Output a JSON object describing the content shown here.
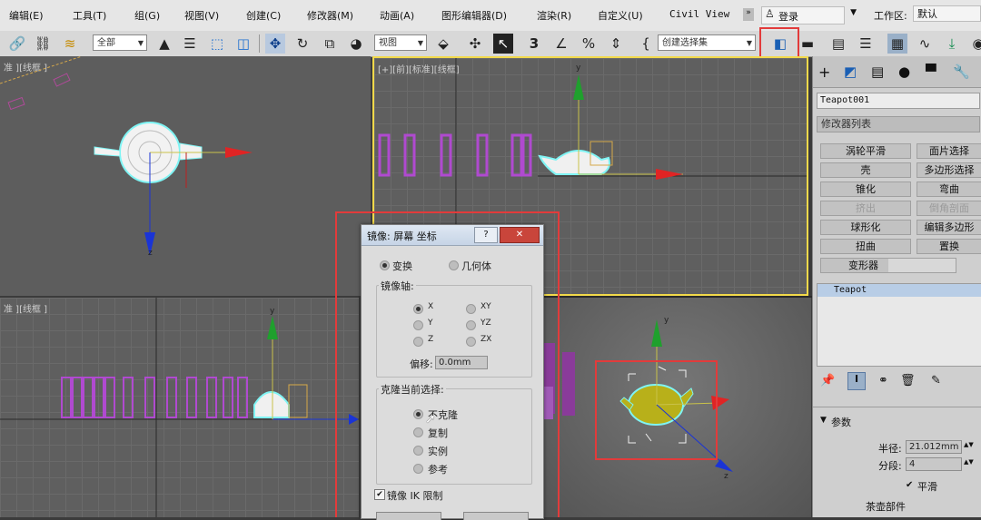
{
  "menubar": {
    "items": [
      "编辑(E)",
      "工具(T)",
      "组(G)",
      "视图(V)",
      "创建(C)",
      "修改器(M)",
      "动画(A)",
      "图形编辑器(D)",
      "渲染(R)",
      "自定义(U)",
      "Civil View"
    ],
    "login": "登录",
    "workspace_label": "工作区:",
    "workspace_value": "默认"
  },
  "toolbar": {
    "filter_combo": "全部",
    "coord_combo": "视图",
    "selection_set": "创建选择集",
    "icons": [
      "link-icon",
      "unlink-icon",
      "bind-space-warp-icon",
      "select-object-icon",
      "select-by-name-icon",
      "rect-region-icon",
      "window-crossing-icon",
      "move-icon",
      "rotate-icon",
      "scale-icon",
      "place-icon",
      "pivot-icon",
      "select-manipulate-icon",
      "keyboard-shortcut-icon",
      "snap-3-icon",
      "angle-snap-icon",
      "percent-snap-icon",
      "spinner-snap-icon",
      "edit-named-selections-icon",
      "mirror-icon",
      "align-icon",
      "scene-explorer-icon",
      "layer-explorer-icon",
      "ribbon-icon",
      "curve-editor-icon",
      "schematic-view-icon",
      "material-editor-icon"
    ]
  },
  "viewports": {
    "top_left_label": "准 ][线框 ]",
    "top_right_label": "[+][前][标准][线框]",
    "bottom_left_label": "准 ][线框 ]"
  },
  "axes": {
    "y": "y",
    "z": "z"
  },
  "command_panel": {
    "object_name": "Teapot001",
    "modifier_list": "修改器列表",
    "modifier_buttons": [
      {
        "label": "涡轮平滑",
        "enabled": true
      },
      {
        "label": "面片选择",
        "enabled": true
      },
      {
        "label": "壳",
        "enabled": true
      },
      {
        "label": "多边形选择",
        "enabled": true
      },
      {
        "label": "锥化",
        "enabled": true
      },
      {
        "label": "弯曲",
        "enabled": true
      },
      {
        "label": "挤出",
        "enabled": false
      },
      {
        "label": "倒角剖面",
        "enabled": false
      },
      {
        "label": "球形化",
        "enabled": true
      },
      {
        "label": "编辑多边形",
        "enabled": true
      },
      {
        "label": "扭曲",
        "enabled": true
      },
      {
        "label": "置换",
        "enabled": true
      },
      {
        "label": "变形器",
        "enabled": true
      }
    ],
    "stack_item": "Teapot",
    "params_title": "参数",
    "radius_label": "半径:",
    "radius_value": "21.012mm",
    "segments_label": "分段:",
    "segments_value": "4",
    "smooth_label": "平滑",
    "teapot_parts_label": "茶壶部件"
  },
  "mirror_dialog": {
    "title": "镜像: 屏幕 坐标",
    "help": "?",
    "close": "✕",
    "mode_transform": "变换",
    "mode_geometry": "几何体",
    "mode_selected": "transform",
    "axis_group": "镜像轴:",
    "axes": [
      "X",
      "Y",
      "Z",
      "XY",
      "YZ",
      "ZX"
    ],
    "axis_selected": "X",
    "offset_label": "偏移:",
    "offset_value": "0.0mm",
    "clone_group": "克隆当前选择:",
    "clone_options": [
      "不克隆",
      "复制",
      "实例",
      "参考"
    ],
    "clone_selected": "不克隆",
    "ik_label": "镜像 IK 限制",
    "ik_checked": true
  },
  "colors": {
    "highlight": "#e23b3b",
    "active_viewport": "#f2d94a",
    "selection_cyan": "#7ff4f4"
  }
}
